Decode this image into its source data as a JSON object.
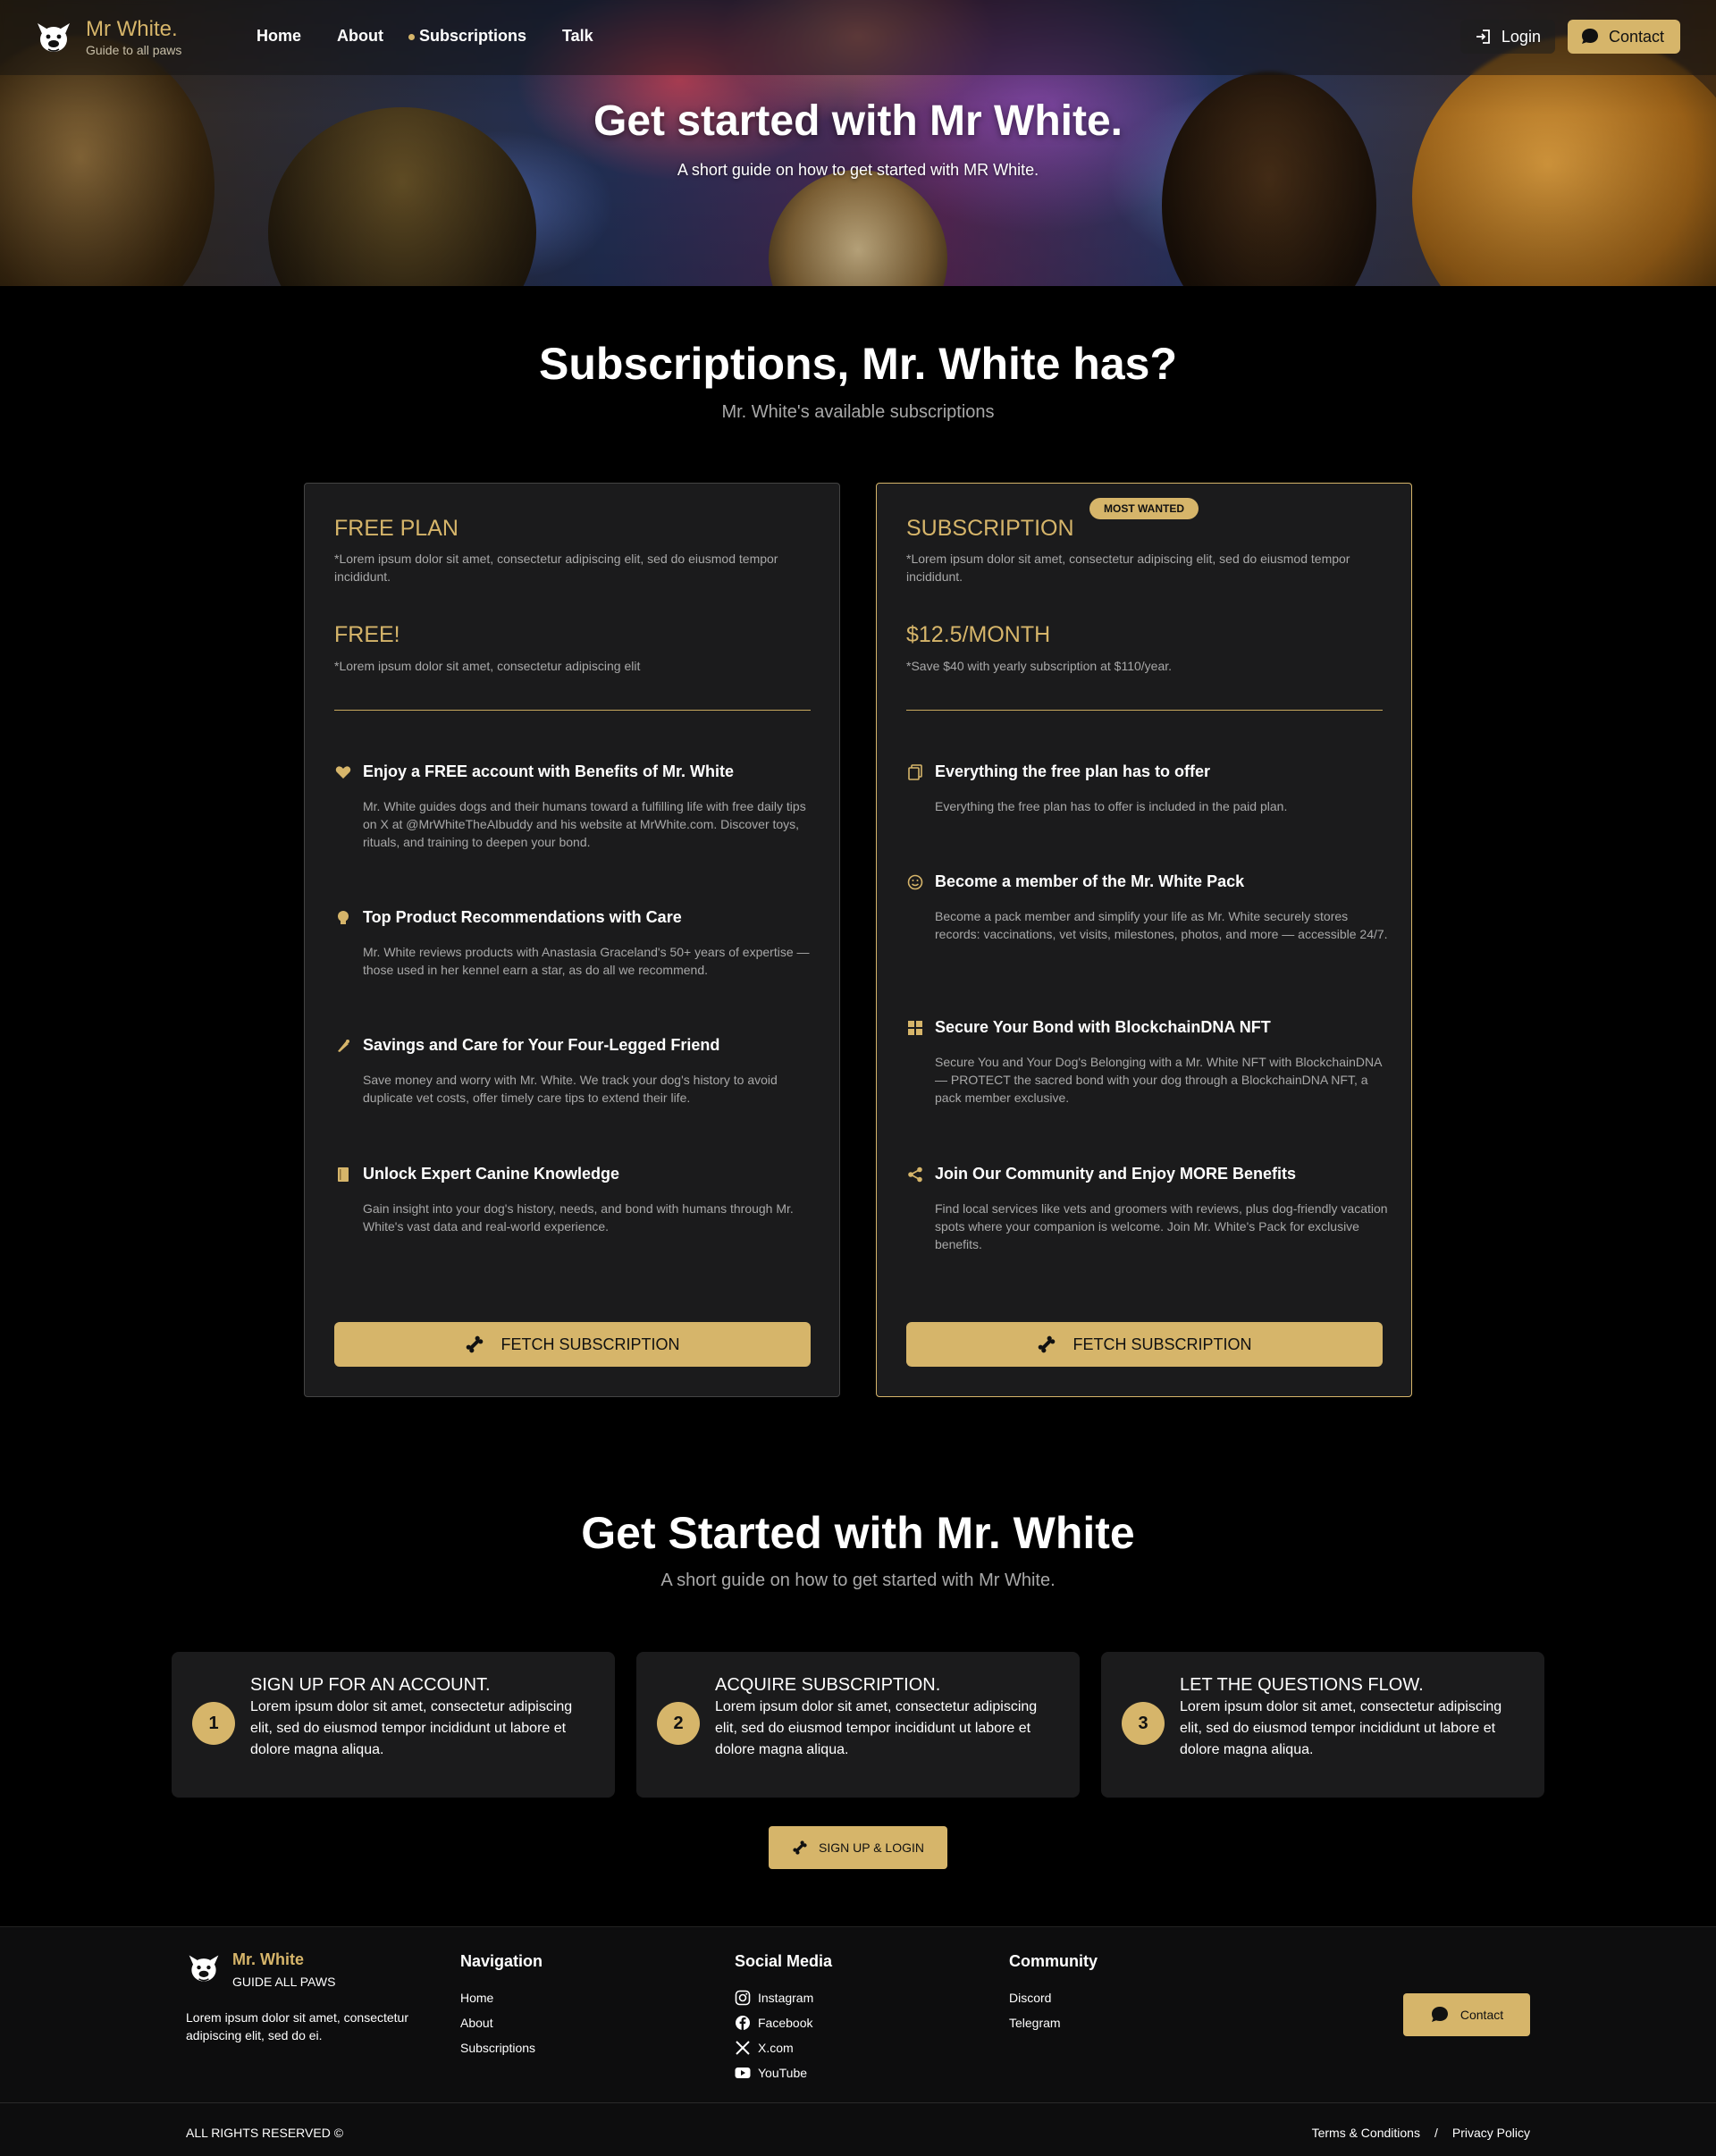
{
  "brand": {
    "name": "Mr White.",
    "tagline": "Guide to all paws"
  },
  "nav": {
    "links": [
      {
        "label": "Home"
      },
      {
        "label": "About"
      },
      {
        "label": "Subscriptions",
        "active": true
      },
      {
        "label": "Talk"
      }
    ],
    "login_label": "Login",
    "contact_label": "Contact"
  },
  "hero": {
    "title": "Get started with Mr White.",
    "subtitle": "A short guide on how to get started with MR White."
  },
  "plans_section": {
    "title": "Subscriptions, Mr. White has?",
    "subtitle": "Mr. White's available subscriptions"
  },
  "plans": [
    {
      "name": "FREE PLAN",
      "description": "*Lorem ipsum dolor sit amet, consectetur adipiscing elit, sed do eiusmod tempor incididunt.",
      "price": "FREE!",
      "price_note": "*Lorem ipsum dolor sit amet, consectetur adipiscing elit",
      "features": [
        {
          "icon": "heart-icon",
          "title": "Enjoy a FREE account with Benefits of Mr. White",
          "text": "Mr. White guides dogs and their humans toward a fulfilling life with free daily tips on X at @MrWhiteTheAIbuddy and his website at MrWhite.com. Discover toys, rituals, and training to deepen your bond."
        },
        {
          "icon": "lightbulb-icon",
          "title": "Top Product Recommendations with Care",
          "text": "Mr. White reviews products with Anastasia Graceland's 50+ years of expertise — those used in her kennel earn a star, as do all we recommend."
        },
        {
          "icon": "piggy-bank-icon",
          "title": "Savings and Care for Your Four-Legged Friend",
          "text": "Save money and worry with Mr. White. We track your dog's history to avoid duplicate vet costs, offer timely care tips to extend their life."
        },
        {
          "icon": "book-icon",
          "title": "Unlock Expert Canine Knowledge",
          "text": "Gain insight into your dog's history, needs, and bond with humans through Mr. White's vast data and real-world experience."
        }
      ],
      "button_label": "FETCH SUBSCRIPTION"
    },
    {
      "name": "SUBSCRIPTION",
      "badge": "MOST WANTED",
      "description": "*Lorem ipsum dolor sit amet, consectetur adipiscing elit, sed do eiusmod tempor incididunt.",
      "price": "$12.5/MONTH",
      "price_note": "*Save $40 with yearly subscription at $110/year.",
      "features": [
        {
          "icon": "copy-icon",
          "title": "Everything the free plan has to offer",
          "text": "Everything the free plan has to offer is included in the paid plan."
        },
        {
          "icon": "smiley-icon",
          "title": "Become a member of the Mr. White Pack",
          "text": "Become a pack member and simplify your life as Mr. White securely stores records: vaccinations, vet visits, milestones, photos, and more — accessible 24/7."
        },
        {
          "icon": "grid-icon",
          "title": "Secure Your Bond with BlockchainDNA NFT",
          "text": "Secure You and Your Dog's Belonging with a Mr. White NFT with BlockchainDNA — PROTECT the sacred bond with your dog through a BlockchainDNA NFT, a pack member exclusive."
        },
        {
          "icon": "share-icon",
          "title": "Join Our Community and Enjoy MORE Benefits",
          "text": "Find local services like vets and groomers with reviews, plus dog-friendly vacation spots where your companion is welcome. Join Mr. White's Pack for exclusive benefits."
        }
      ],
      "button_label": "FETCH SUBSCRIPTION"
    }
  ],
  "get_started": {
    "title": "Get Started with Mr. White",
    "subtitle": "A short guide on how to get started with Mr White.",
    "steps": [
      {
        "number": "1",
        "title": "SIGN UP FOR AN ACCOUNT.",
        "text": "Lorem ipsum dolor sit amet, consectetur adipiscing elit, sed do eiusmod tempor incididunt ut labore et dolore magna aliqua."
      },
      {
        "number": "2",
        "title": "ACQUIRE SUBSCRIPTION.",
        "text": "Lorem ipsum dolor sit amet, consectetur adipiscing elit, sed do eiusmod tempor incididunt ut labore et dolore magna aliqua."
      },
      {
        "number": "3",
        "title": "LET THE QUESTIONS FLOW.",
        "text": "Lorem ipsum dolor sit amet, consectetur adipiscing elit, sed do eiusmod tempor incididunt ut labore et dolore magna aliqua."
      }
    ],
    "button_label": "SIGN UP & LOGIN"
  },
  "footer": {
    "brand_name": "Mr. White",
    "brand_tag": "GUIDE ALL PAWS",
    "description": "Lorem ipsum dolor sit amet, consectetur adipiscing elit, sed do ei.",
    "navigation": {
      "heading": "Navigation",
      "links": [
        "Home",
        "About",
        "Subscriptions"
      ]
    },
    "social": {
      "heading": "Social Media",
      "links": [
        {
          "label": "Instagram",
          "icon": "instagram-icon"
        },
        {
          "label": "Facebook",
          "icon": "facebook-icon"
        },
        {
          "label": "X.com",
          "icon": "x-icon"
        },
        {
          "label": "YouTube",
          "icon": "youtube-icon"
        }
      ]
    },
    "community": {
      "heading": "Community",
      "links": [
        "Discord",
        "Telegram"
      ]
    },
    "contact_label": "Contact",
    "rights": "ALL RIGHTS RESERVED ©",
    "terms": "Terms & Conditions",
    "separator": "/",
    "privacy": "Privacy Policy"
  },
  "colors": {
    "accent": "#d6b56a",
    "background": "#000000",
    "card": "#1b1b1c",
    "muted_text": "#a8a8a8"
  }
}
